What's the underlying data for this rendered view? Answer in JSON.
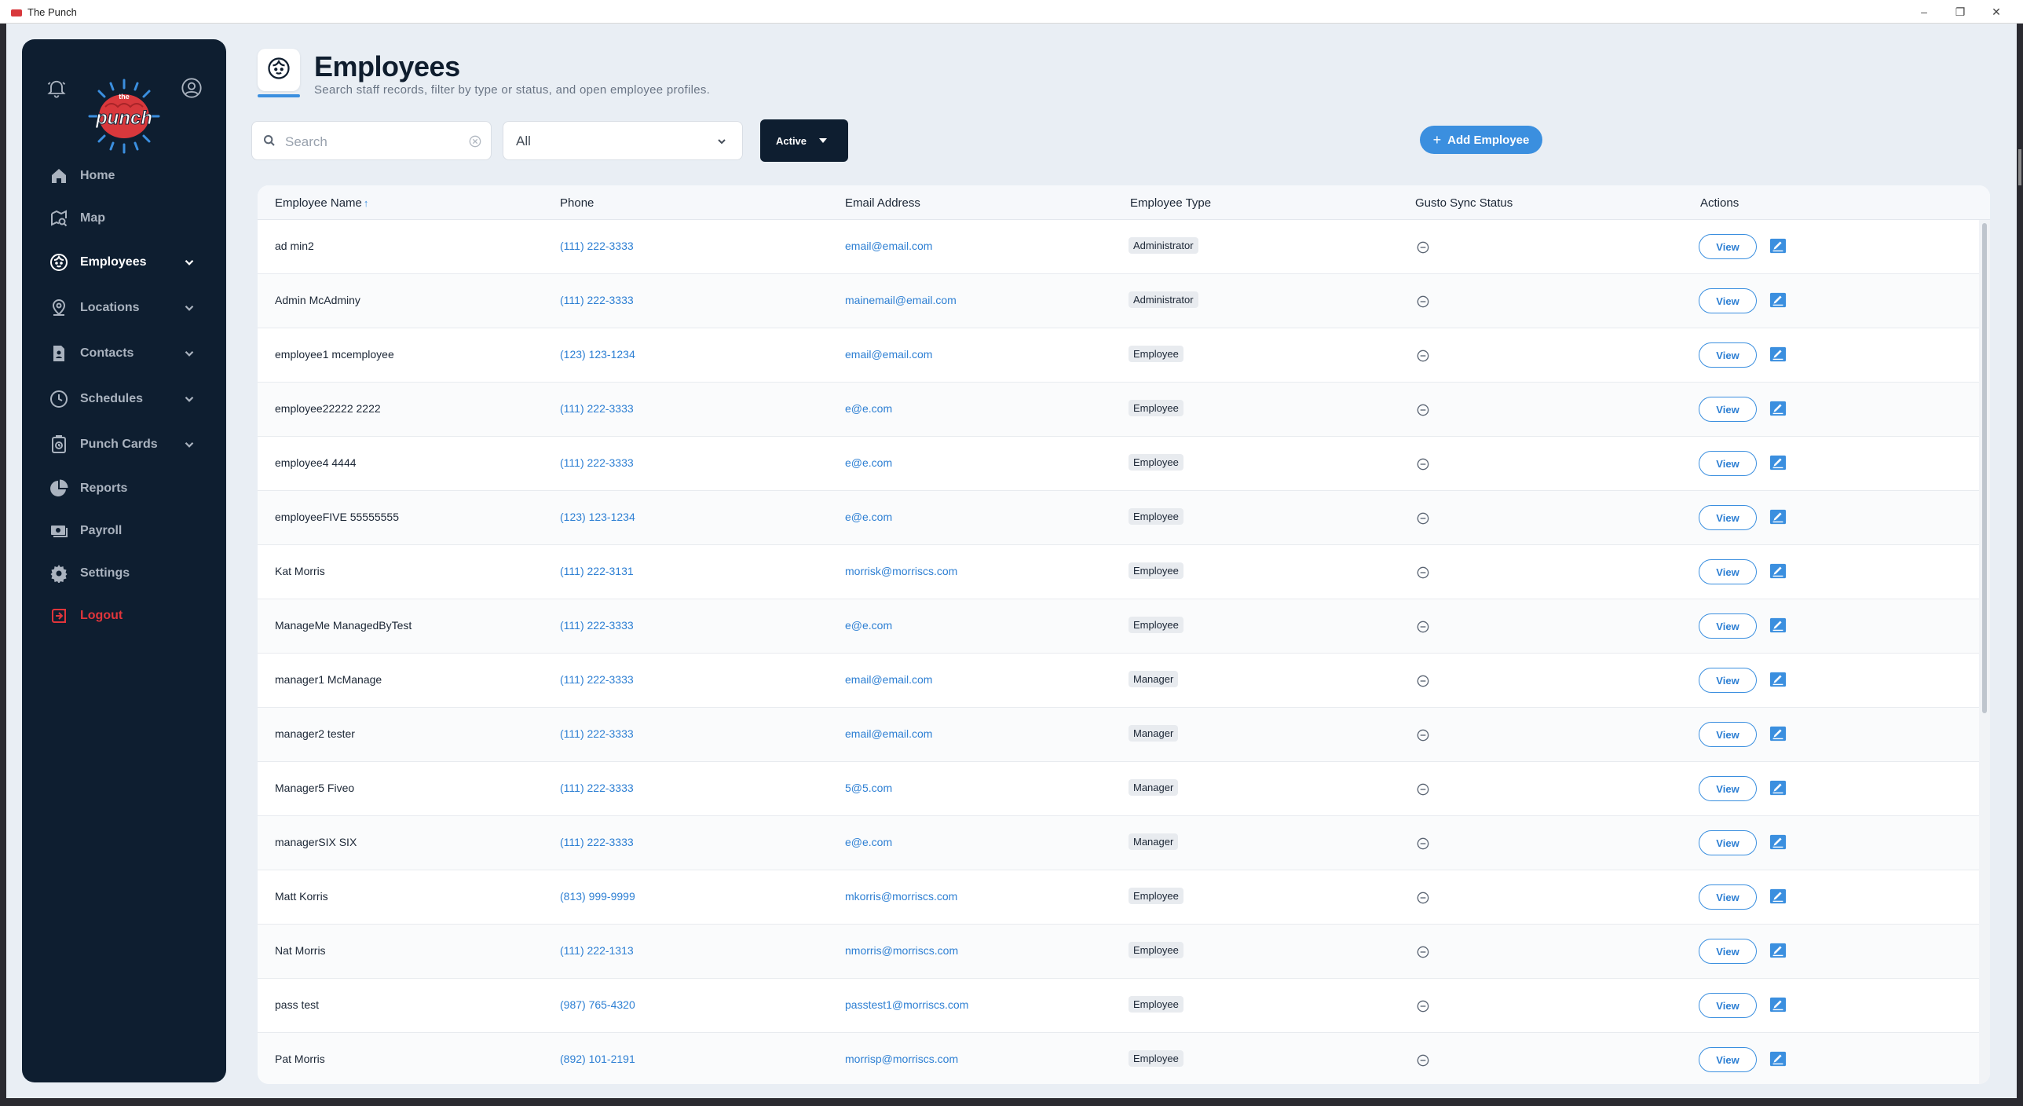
{
  "window": {
    "title": "The Punch"
  },
  "header": {
    "title": "Employees",
    "subtitle": "Search staff records, filter by type or status, and open employee profiles."
  },
  "sidebar": {
    "items": [
      {
        "label": "Home",
        "icon": "home-icon",
        "has_chevron": false,
        "active": false
      },
      {
        "label": "Map",
        "icon": "map-search-icon",
        "has_chevron": false,
        "active": false
      },
      {
        "label": "Employees",
        "icon": "employee-face-icon",
        "has_chevron": true,
        "active": true
      },
      {
        "label": "Locations",
        "icon": "location-pin-icon",
        "has_chevron": true,
        "active": false
      },
      {
        "label": "Contacts",
        "icon": "contact-card-icon",
        "has_chevron": true,
        "active": false
      },
      {
        "label": "Schedules",
        "icon": "clock-icon",
        "has_chevron": true,
        "active": false
      },
      {
        "label": "Punch Cards",
        "icon": "punch-card-icon",
        "has_chevron": true,
        "active": false
      },
      {
        "label": "Reports",
        "icon": "pie-chart-icon",
        "has_chevron": false,
        "active": false
      },
      {
        "label": "Payroll",
        "icon": "payroll-icon",
        "has_chevron": false,
        "active": false
      },
      {
        "label": "Settings",
        "icon": "gear-icon",
        "has_chevron": false,
        "active": false
      },
      {
        "label": "Logout",
        "icon": "logout-icon",
        "has_chevron": false,
        "active": false
      }
    ]
  },
  "filters": {
    "search_placeholder": "Search",
    "type_select": "All",
    "status_button": "Active",
    "add_button": "Add Employee"
  },
  "table": {
    "columns": [
      "Employee Name",
      "Phone",
      "Email Address",
      "Employee Type",
      "Gusto Sync Status",
      "Actions"
    ],
    "sort_indicator": "↑",
    "view_label": "View",
    "rows": [
      {
        "name": "ad min2",
        "phone": "(111) 222-3333",
        "email": "email@email.com",
        "type": "Administrator"
      },
      {
        "name": "Admin McAdminy",
        "phone": "(111) 222-3333",
        "email": "mainemail@email.com",
        "type": "Administrator"
      },
      {
        "name": "employee1 mcemployee",
        "phone": "(123) 123-1234",
        "email": "email@email.com",
        "type": "Employee"
      },
      {
        "name": "employee22222 2222",
        "phone": "(111) 222-3333",
        "email": "e@e.com",
        "type": "Employee"
      },
      {
        "name": "employee4 4444",
        "phone": "(111) 222-3333",
        "email": "e@e.com",
        "type": "Employee"
      },
      {
        "name": "employeeFIVE 55555555",
        "phone": "(123) 123-1234",
        "email": "e@e.com",
        "type": "Employee"
      },
      {
        "name": "Kat Morris",
        "phone": "(111) 222-3131",
        "email": "morrisk@morriscs.com",
        "type": "Employee"
      },
      {
        "name": "ManageMe ManagedByTest",
        "phone": "(111) 222-3333",
        "email": "e@e.com",
        "type": "Employee"
      },
      {
        "name": "manager1 McManage",
        "phone": "(111) 222-3333",
        "email": "email@email.com",
        "type": "Manager"
      },
      {
        "name": "manager2 tester",
        "phone": "(111) 222-3333",
        "email": "email@email.com",
        "type": "Manager"
      },
      {
        "name": "Manager5 Fiveo",
        "phone": "(111) 222-3333",
        "email": "5@5.com",
        "type": "Manager"
      },
      {
        "name": "managerSIX SIX",
        "phone": "(111) 222-3333",
        "email": "e@e.com",
        "type": "Manager"
      },
      {
        "name": "Matt Korris",
        "phone": "(813) 999-9999",
        "email": "mkorris@morriscs.com",
        "type": "Employee"
      },
      {
        "name": "Nat Morris",
        "phone": "(111) 222-1313",
        "email": "nmorris@morriscs.com",
        "type": "Employee"
      },
      {
        "name": "pass test",
        "phone": "(987) 765-4320",
        "email": "passtest1@morriscs.com",
        "type": "Employee"
      },
      {
        "name": "Pat Morris",
        "phone": "(892) 101-2191",
        "email": "morrisp@morriscs.com",
        "type": "Employee"
      }
    ]
  },
  "colors": {
    "sidebar_bg": "#0e1e30",
    "accent": "#3b8fdf",
    "logout": "#e0353b",
    "app_bg": "#e9eef4"
  }
}
